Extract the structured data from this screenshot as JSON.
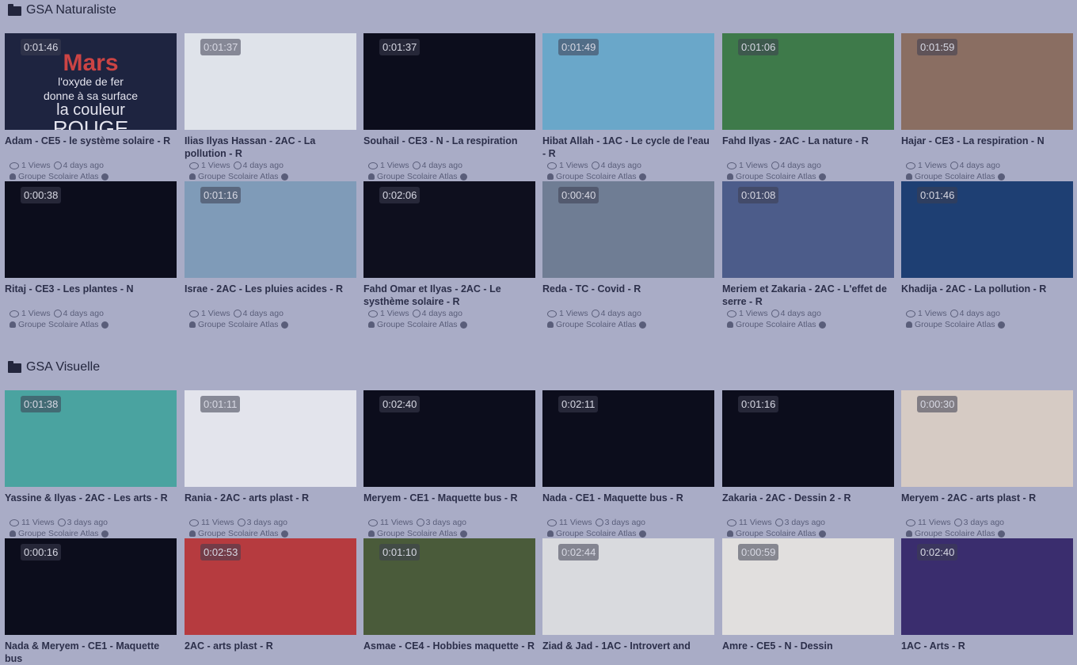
{
  "sections": [
    {
      "title": "GSA Naturaliste",
      "videos": [
        {
          "duration": "0:01:46",
          "title": "Adam - CE5 - le système solaire - R",
          "views": "1 Views",
          "date": "4 days ago",
          "channel": "Groupe Scolaire Atlas",
          "thumb_text": [
            "Mars",
            "l'oxyde de fer",
            "donne à sa surface",
            "la couleur",
            "ROUGE"
          ]
        },
        {
          "duration": "0:01:37",
          "title": "Ilias Ilyas Hassan - 2AC - La pollution - R",
          "views": "1 Views",
          "date": "4 days ago",
          "channel": "Groupe Scolaire Atlas"
        },
        {
          "duration": "0:01:37",
          "title": "Souhail - CE3 - N - La respiration",
          "views": "1 Views",
          "date": "4 days ago",
          "channel": "Groupe Scolaire Atlas"
        },
        {
          "duration": "0:01:49",
          "title": "Hibat Allah - 1AC - Le cycle de l'eau - R",
          "views": "1 Views",
          "date": "4 days ago",
          "channel": "Groupe Scolaire Atlas"
        },
        {
          "duration": "0:01:06",
          "title": "Fahd Ilyas - 2AC - La nature - R",
          "views": "1 Views",
          "date": "4 days ago",
          "channel": "Groupe Scolaire Atlas"
        },
        {
          "duration": "0:01:59",
          "title": "Hajar - CE3 - La respiration - N",
          "views": "1 Views",
          "date": "4 days ago",
          "channel": "Groupe Scolaire Atlas"
        },
        {
          "duration": "0:00:38",
          "title": "Ritaj - CE3 - Les plantes - N",
          "views": "1 Views",
          "date": "4 days ago",
          "channel": "Groupe Scolaire Atlas"
        },
        {
          "duration": "0:01:16",
          "title": "Israe - 2AC - Les pluies acides - R",
          "views": "1 Views",
          "date": "4 days ago",
          "channel": "Groupe Scolaire Atlas"
        },
        {
          "duration": "0:02:06",
          "title": "Fahd Omar et Ilyas - 2AC - Le systhème solaire - R",
          "views": "1 Views",
          "date": "4 days ago",
          "channel": "Groupe Scolaire Atlas"
        },
        {
          "duration": "0:00:40",
          "title": "Reda - TC - Covid - R",
          "views": "1 Views",
          "date": "4 days ago",
          "channel": "Groupe Scolaire Atlas"
        },
        {
          "duration": "0:01:08",
          "title": "Meriem et Zakaria - 2AC - L'effet de serre - R",
          "views": "1 Views",
          "date": "4 days ago",
          "channel": "Groupe Scolaire Atlas"
        },
        {
          "duration": "0:01:46",
          "title": "Khadija - 2AC - La pollution - R",
          "views": "1 Views",
          "date": "4 days ago",
          "channel": "Groupe Scolaire Atlas"
        }
      ]
    },
    {
      "title": "GSA Visuelle",
      "videos": [
        {
          "duration": "0:01:38",
          "title": "Yassine & Ilyas - 2AC - Les arts - R",
          "views": "11 Views",
          "date": "3 days ago",
          "channel": "Groupe Scolaire Atlas"
        },
        {
          "duration": "0:01:11",
          "title": "Rania - 2AC - arts plast - R",
          "views": "11 Views",
          "date": "3 days ago",
          "channel": "Groupe Scolaire Atlas"
        },
        {
          "duration": "0:02:40",
          "title": "Meryem - CE1 - Maquette bus - R",
          "views": "11 Views",
          "date": "3 days ago",
          "channel": "Groupe Scolaire Atlas"
        },
        {
          "duration": "0:02:11",
          "title": "Nada - CE1 - Maquette bus - R",
          "views": "11 Views",
          "date": "3 days ago",
          "channel": "Groupe Scolaire Atlas"
        },
        {
          "duration": "0:01:16",
          "title": "Zakaria - 2AC - Dessin 2 - R",
          "views": "11 Views",
          "date": "3 days ago",
          "channel": "Groupe Scolaire Atlas"
        },
        {
          "duration": "0:00:30",
          "title": "Meryem - 2AC - arts plast - R",
          "views": "11 Views",
          "date": "3 days ago",
          "channel": "Groupe Scolaire Atlas"
        },
        {
          "duration": "0:00:16",
          "title": "Nada & Meryem - CE1 - Maquette bus",
          "views": "",
          "date": "",
          "channel": ""
        },
        {
          "duration": "0:02:53",
          "title": "2AC - arts plast - R",
          "views": "",
          "date": "",
          "channel": ""
        },
        {
          "duration": "0:01:10",
          "title": "Asmae - CE4 - Hobbies maquette - R",
          "views": "",
          "date": "",
          "channel": ""
        },
        {
          "duration": "0:02:44",
          "title": "Ziad & Jad - 1AC - Introvert and",
          "views": "",
          "date": "",
          "channel": ""
        },
        {
          "duration": "0:00:59",
          "title": "Amre - CE5 - N - Dessin",
          "views": "",
          "date": "",
          "channel": ""
        },
        {
          "duration": "0:02:40",
          "title": "1AC - Arts - R",
          "views": "",
          "date": "",
          "channel": ""
        }
      ]
    }
  ],
  "thumb_palette": [
    "#1e2440",
    "#dfe3ea",
    "#0c0d1c",
    "#6aa7c9",
    "#3e7a4a",
    "#8a6e62",
    "#0c0d1c",
    "#7f9bb8",
    "#0e0f1e",
    "#6f7d94",
    "#4c5c8a",
    "#1e3f73",
    "#4aa3a0",
    "#e3e4ec",
    "#0c0d1c",
    "#0c0d1c",
    "#0c0d1c",
    "#d6cbc4",
    "#0c0d1c",
    "#b63b3f",
    "#4a5b3a",
    "#d9dade",
    "#e1dfde",
    "#3a2d6e"
  ]
}
